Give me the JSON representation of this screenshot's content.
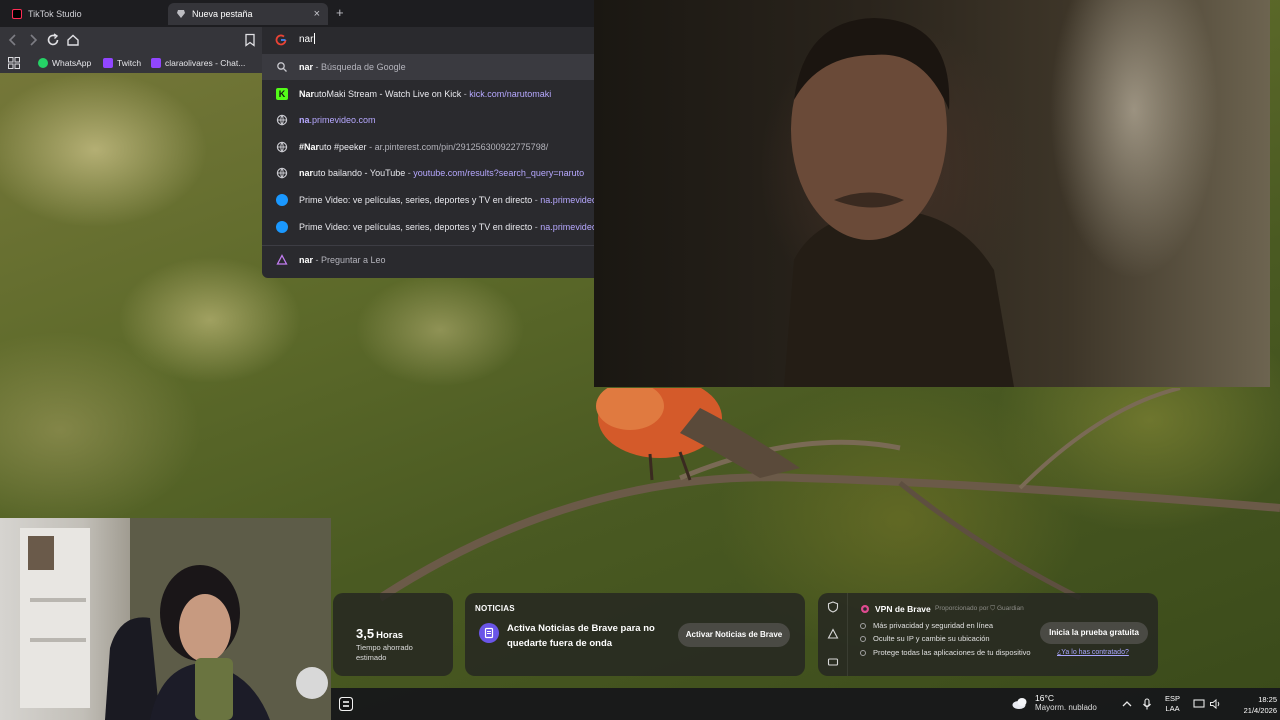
{
  "browser": {
    "tabs": [
      {
        "label": "TikTok Studio",
        "active": false
      },
      {
        "label": "Nueva pestaña",
        "active": true
      }
    ],
    "new_tab_symbol": "+",
    "close_symbol": "×",
    "address_bar": {
      "value": "nar"
    },
    "bookmarks": [
      {
        "label": "WhatsApp",
        "icon": "whatsapp-icon",
        "color": "#25d366"
      },
      {
        "label": "Twitch",
        "icon": "twitch-icon",
        "color": "#9146ff"
      },
      {
        "label": "claraolivares - Chat...",
        "icon": "twitch-icon",
        "color": "#9146ff"
      }
    ],
    "suggestions": [
      {
        "icon": "search-icon",
        "bold": "nar",
        "rest": "",
        "sep": " - ",
        "detail": "Búsqueda de Google",
        "detail_kind": "muted"
      },
      {
        "icon": "kick-icon",
        "bold": "Nar",
        "rest": "utoMaki Stream - Watch Live on Kick",
        "sep": " - ",
        "detail": "kick.com/narutomaki",
        "detail_kind": "link"
      },
      {
        "icon": "globe-icon",
        "bold": "na",
        "rest": ".primevideo.com",
        "sep": "",
        "detail": "",
        "detail_kind": "link"
      },
      {
        "icon": "globe-icon",
        "bold": "#Nar",
        "rest": "uto #peeker",
        "sep": " - ",
        "detail": "ar.pinterest.com/pin/291256300922775798/",
        "detail_kind": "muted"
      },
      {
        "icon": "globe-icon",
        "bold": "nar",
        "rest": "uto bailando - YouTube",
        "sep": " - ",
        "detail": "youtube.com/results?search_query=naruto",
        "detail_kind": "link"
      },
      {
        "icon": "prime-video-icon",
        "bold": "",
        "rest": "Prime Video: ve películas, series, deportes y TV en directo",
        "sep": " - ",
        "detail": "na.primevideo.com",
        "detail_kind": "link"
      },
      {
        "icon": "prime-video-icon",
        "bold": "",
        "rest": "Prime Video: ve películas, series, deportes y TV en directo",
        "sep": " - ",
        "detail": "na.primevideo.com",
        "detail_kind": "link"
      },
      {
        "icon": "leo-icon",
        "bold": "nar",
        "rest": "",
        "sep": " - ",
        "detail": "Preguntar a Leo",
        "detail_kind": "muted"
      }
    ]
  },
  "widgets": {
    "time_saved": {
      "value": "3,5",
      "unit": "Horas",
      "caption": "Tiempo ahorrado estimado"
    },
    "news": {
      "heading": "NOTICIAS",
      "text": "Activa Noticias de Brave para no quedarte fuera de onda",
      "button": "Activar Noticias de Brave"
    },
    "vpn": {
      "title": "VPN de Brave",
      "provided_by": "Proporcionado por",
      "provider": "Guardian",
      "bullets": [
        "Más privacidad y seguridad en línea",
        "Oculte su IP y cambie su ubicación",
        "Protege todas las aplicaciones de tu dispositivo"
      ],
      "trial_button": "Inicia la prueba gratuita",
      "contracted_link": "¿Ya lo has contratado?"
    }
  },
  "taskbar": {
    "weather": {
      "temp": "16°C",
      "desc": "Mayorm. nublado"
    },
    "language": {
      "line1": "ESP",
      "line2": "LAA"
    },
    "clock": {
      "time": "18:25",
      "date": "21/4/2026"
    }
  }
}
